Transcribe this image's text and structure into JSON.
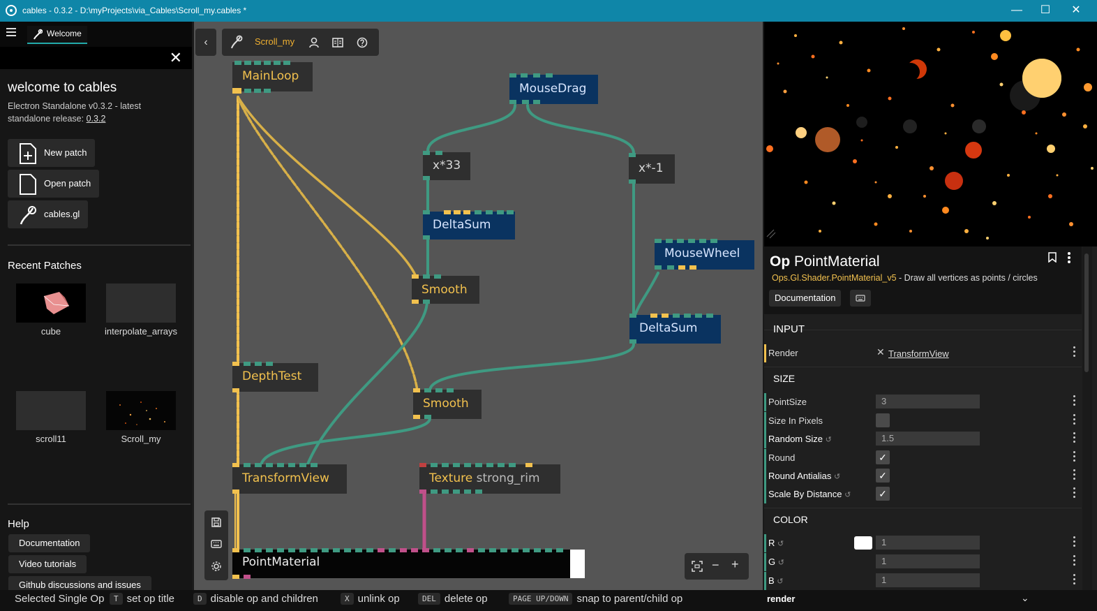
{
  "window": {
    "title": "cables - 0.3.2 - D:\\myProjects\\via_Cables\\Scroll_my.cables *",
    "minimize": "—",
    "maximize": "☐",
    "close": "✕"
  },
  "sidebar": {
    "tab_label": "Welcome",
    "close_symbol": "✕",
    "heading": "welcome to cables",
    "subtitle_line1": "Electron Standalone v0.3.2 - latest",
    "subtitle_line2_prefix": "standalone release: ",
    "release_link": "0.3.2",
    "buttons": {
      "new_patch": "New patch",
      "open_patch": "Open patch",
      "cables_gl": "cables.gl"
    },
    "recent_heading": "Recent Patches",
    "recent": [
      {
        "name": "cube"
      },
      {
        "name": "interpolate_arrays"
      },
      {
        "name": "scroll11"
      },
      {
        "name": "Scroll_my"
      }
    ],
    "help_heading": "Help",
    "help": {
      "documentation": "Documentation",
      "video_tutorials": "Video tutorials",
      "github": "Github discussions and issues"
    }
  },
  "canvas": {
    "back_symbol": "‹",
    "patch_name": "Scroll_my",
    "ops": {
      "mainloop": "MainLoop",
      "mousedrag": "MouseDrag",
      "x33": "x*33",
      "xm1": "x*-1",
      "deltasum1": "DeltaSum",
      "mousewheel": "MouseWheel",
      "smooth1": "Smooth",
      "deltasum2": "DeltaSum",
      "depthtest": "DepthTest",
      "smooth2": "Smooth",
      "transformview": "TransformView",
      "texture": "Texture",
      "texture_sub": "strong_rim",
      "pointmaterial": "PointMaterial"
    },
    "zoom": {
      "minus": "−",
      "plus": "+"
    }
  },
  "panel": {
    "op_prefix": "Op",
    "op_name": "PointMaterial",
    "op_path": "Ops.Gl.Shader.PointMaterial_v5",
    "op_desc": " - Draw all vertices as points / circles",
    "doc_button": "Documentation",
    "input_heading": "INPUT",
    "render_label": "Render",
    "render_link": "TransformView",
    "size_heading": "SIZE",
    "pointsize_label": "PointSize",
    "pointsize_value": "3",
    "sizeinpixels_label": "Size In Pixels",
    "randomsize_label": "Random Size",
    "randomsize_value": "1.5",
    "round_label": "Round",
    "roundaa_label": "Round Antialias",
    "scalebydist_label": "Scale By Distance",
    "color_heading": "COLOR",
    "r_label": "R",
    "r_value": "1",
    "g_label": "G",
    "g_value": "1",
    "b_label": "B",
    "b_value": "1",
    "reset_symbol": "↺"
  },
  "statusbar": {
    "selected": "Selected Single Op",
    "k1": "T",
    "a1": "set op title",
    "k2": "D",
    "a2": "disable op and children",
    "k3": "X",
    "a3": "unlink op",
    "k4": "DEL",
    "a4": "delete op",
    "k5": "PAGE UP/DOWN",
    "a5": "snap to parent/child op"
  },
  "render_select": {
    "value": "render"
  },
  "colors": {
    "titlebar": "#0f86a8",
    "trigger_port": "#f2c14e",
    "number_port": "#3f9a82",
    "texture_port": "#c0508a",
    "canvas_bg": "#555555"
  }
}
